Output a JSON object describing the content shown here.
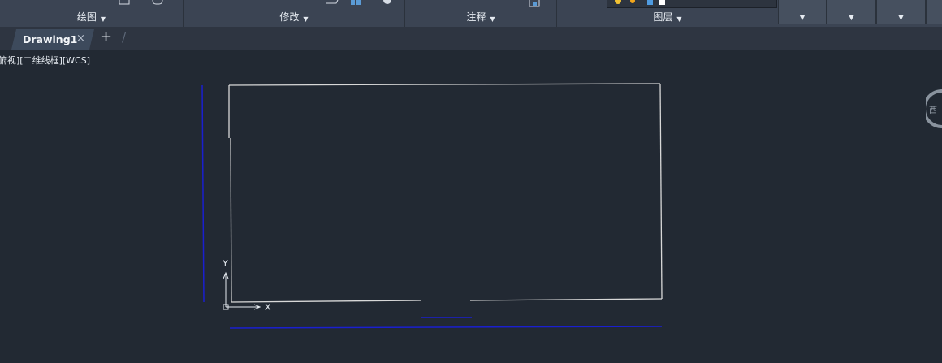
{
  "ribbon": {
    "panels": [
      {
        "label": "绘图"
      },
      {
        "label": "修改"
      },
      {
        "label": "注释"
      },
      {
        "label": "图层"
      }
    ]
  },
  "document": {
    "tab_label": "Drawing1",
    "close_glyph": "×",
    "new_tab_glyph": "+"
  },
  "viewport": {
    "label": "俯视][二维线框][WCS]"
  },
  "ucs": {
    "x_label": "X",
    "y_label": "Y"
  },
  "viewcube": {
    "west_label": "西"
  },
  "colors": {
    "background": "#222933",
    "ribbon": "#3b4453",
    "geometry": "#d8d8d8",
    "blue_lines": "#1a1fd0"
  }
}
